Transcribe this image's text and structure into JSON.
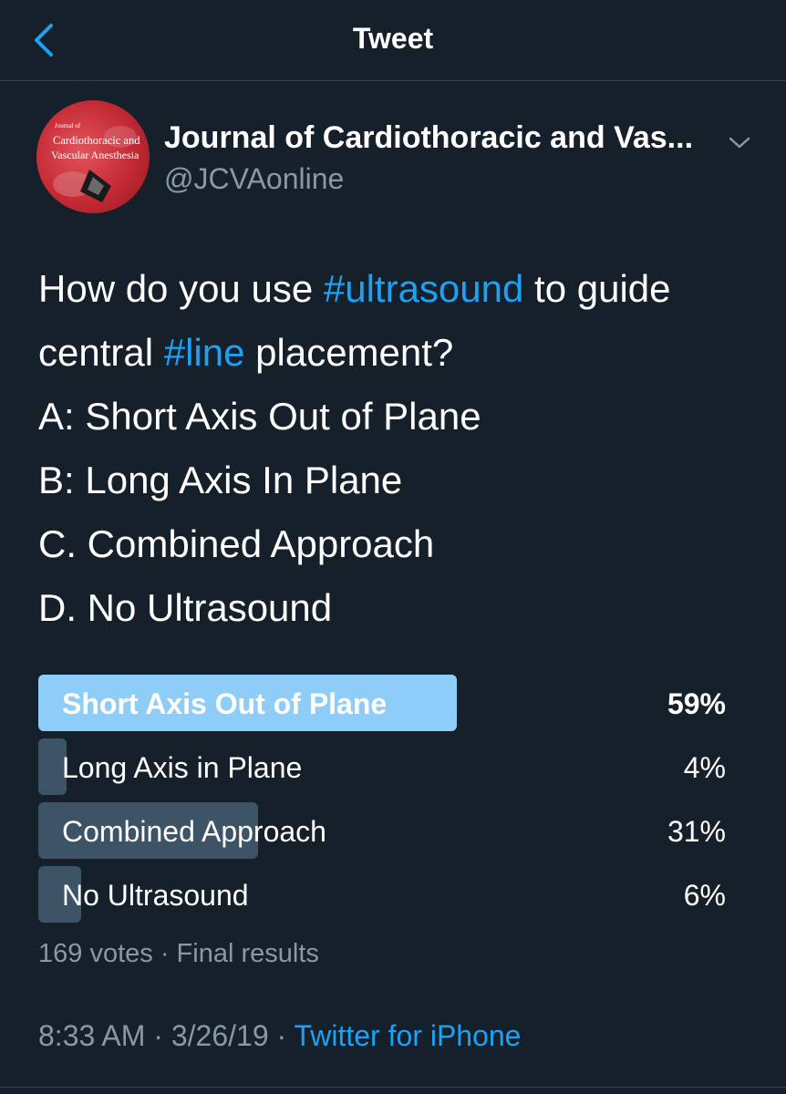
{
  "header": {
    "title": "Tweet"
  },
  "colors": {
    "background": "#15202b",
    "accent": "#1da1f2",
    "muted": "#8899a6",
    "winner_bar": "#8ecdf8",
    "bar": "#3d5466"
  },
  "author": {
    "name": "Journal of Cardiothoracic and Vas...",
    "handle": "@JCVAonline",
    "logo_line1": "Journal of",
    "logo_line2": "Cardiothoracic and",
    "logo_line3": "Vascular Anesthesia"
  },
  "tweet": {
    "line1_pre": "How do you use ",
    "line1_tag": "#ultrasound",
    "line1_post": " to guide",
    "line2_pre": "central ",
    "line2_tag": "#line",
    "line2_post": " placement?",
    "line3": "A: Short Axis Out of Plane",
    "line4": "B: Long Axis In Plane",
    "line5": "C. Combined Approach",
    "line6": "D. No Ultrasound"
  },
  "poll": {
    "options": [
      {
        "label": "Short Axis Out of Plane",
        "percent_label": "59%",
        "percent": 59,
        "winner": true
      },
      {
        "label": "Long Axis in Plane",
        "percent_label": "4%",
        "percent": 4,
        "winner": false
      },
      {
        "label": "Combined Approach",
        "percent_label": "31%",
        "percent": 31,
        "winner": false
      },
      {
        "label": "No Ultrasound",
        "percent_label": "6%",
        "percent": 6,
        "winner": false
      }
    ],
    "votes": "169 votes",
    "separator": " · ",
    "status": "Final results"
  },
  "meta": {
    "time": "8:33 AM",
    "date": "3/26/19",
    "separator": " · ",
    "source": "Twitter for iPhone"
  },
  "icons": {
    "back": "chevron-left-icon",
    "menu": "chevron-down-icon"
  }
}
